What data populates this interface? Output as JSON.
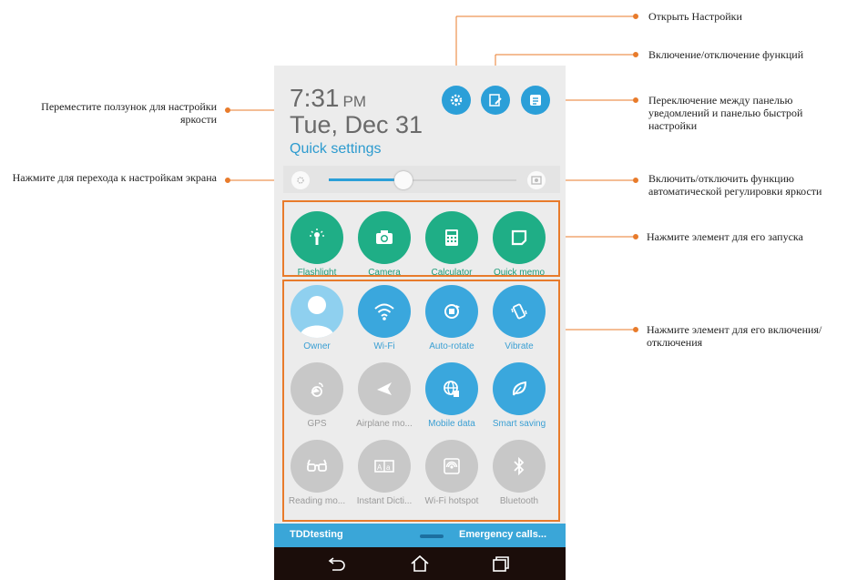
{
  "annotations": {
    "settings": "Открыть Настройки",
    "toggle_features": "Включение/отключение функций",
    "switch_panel": "Переключение между панелью уведомлений и панелью быстрой настройки",
    "slider": "Переместите ползунок для настройки яркости",
    "display_settings": "Нажмите для перехода к настройкам экрана",
    "auto_brightness": "Включить/отключить функцию автоматической регулировки яркости",
    "launch": "Нажмите элемент для его запуска",
    "toggle": "Нажмите элемент для его включения/отключения"
  },
  "phone": {
    "time": "7:31",
    "ampm": "PM",
    "date": "Tue, Dec 31",
    "quick_settings": "Quick settings",
    "brightness_level": 0.4,
    "launch_tiles": [
      {
        "label": "Flashlight",
        "icon": "flashlight-icon"
      },
      {
        "label": "Camera",
        "icon": "camera-icon"
      },
      {
        "label": "Calculator",
        "icon": "calculator-icon"
      },
      {
        "label": "Quick memo",
        "icon": "memo-icon"
      }
    ],
    "toggle_tiles": [
      {
        "label": "Owner",
        "state": "on"
      },
      {
        "label": "Wi-Fi",
        "state": "on"
      },
      {
        "label": "Auto-rotate",
        "state": "on"
      },
      {
        "label": "Vibrate",
        "state": "on"
      },
      {
        "label": "GPS",
        "state": "off"
      },
      {
        "label": "Airplane mo...",
        "state": "off"
      },
      {
        "label": "Mobile data",
        "state": "on"
      },
      {
        "label": "Smart saving",
        "state": "on"
      },
      {
        "label": "Reading mo...",
        "state": "off"
      },
      {
        "label": "Instant Dicti...",
        "state": "off"
      },
      {
        "label": "Wi-Fi hotspot",
        "state": "off"
      },
      {
        "label": "Bluetooth",
        "state": "off"
      }
    ],
    "carrier": "TDDtesting",
    "emergency": "Emergency calls..."
  },
  "colors": {
    "accent": "#2b9fd8",
    "launch_green": "#1fae86",
    "highlight": "#e87b2b"
  }
}
